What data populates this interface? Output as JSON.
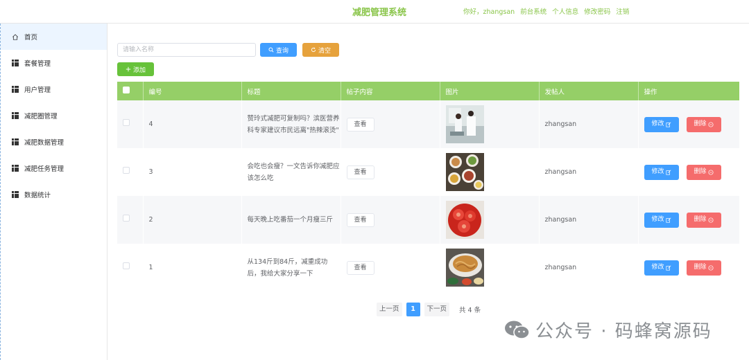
{
  "header": {
    "title": "减肥管理系统",
    "greeting": "你好，zhangsan",
    "links": [
      "前台系统",
      "个人信息",
      "修改密码",
      "注销"
    ]
  },
  "sidebar": {
    "items": [
      {
        "label": "首页",
        "icon": "home-icon"
      },
      {
        "label": "套餐管理",
        "icon": "grid-icon"
      },
      {
        "label": "用户管理",
        "icon": "grid-icon"
      },
      {
        "label": "减肥圈管理",
        "icon": "grid-icon"
      },
      {
        "label": "减肥数据管理",
        "icon": "grid-icon"
      },
      {
        "label": "减肥任务管理",
        "icon": "grid-icon"
      },
      {
        "label": "数据统计",
        "icon": "grid-icon"
      }
    ]
  },
  "toolbar": {
    "search_placeholder": "请输入名称",
    "query_label": "查询",
    "clear_label": "清空",
    "add_label": "添加"
  },
  "table": {
    "columns": [
      "编号",
      "标题",
      "帖子内容",
      "图片",
      "发帖人",
      "操作"
    ],
    "rows": [
      {
        "id": "4",
        "title": "赞玲式减肥可复制吗？滨医营养科专家建议市民远离\"热辣滚烫\"",
        "view": "查看",
        "image": "lab-photo",
        "author": "zhangsan",
        "edit": "修改",
        "delete": "删除"
      },
      {
        "id": "3",
        "title": "会吃也会瘦？一文告诉你减肥应该怎么吃",
        "view": "查看",
        "image": "food-table-photo",
        "author": "zhangsan",
        "edit": "修改",
        "delete": "删除"
      },
      {
        "id": "2",
        "title": "每天晚上吃番茄一个月瘦三斤",
        "view": "查看",
        "image": "tomato-photo",
        "author": "zhangsan",
        "edit": "修改",
        "delete": "删除"
      },
      {
        "id": "1",
        "title": "从134斤到84斤，减重成功后，我给大家分享一下",
        "view": "查看",
        "image": "noodle-dish-photo",
        "author": "zhangsan",
        "edit": "修改",
        "delete": "删除"
      }
    ]
  },
  "pagination": {
    "prev": "上一页",
    "current": "1",
    "next": "下一页",
    "total": "共 4 条"
  },
  "watermark": "公众号 · 码蜂窝源码",
  "colors": {
    "accent": "#95cf67",
    "primary": "#409eff",
    "warning": "#e6a23c",
    "success": "#67c23a",
    "danger": "#f56c6c"
  }
}
